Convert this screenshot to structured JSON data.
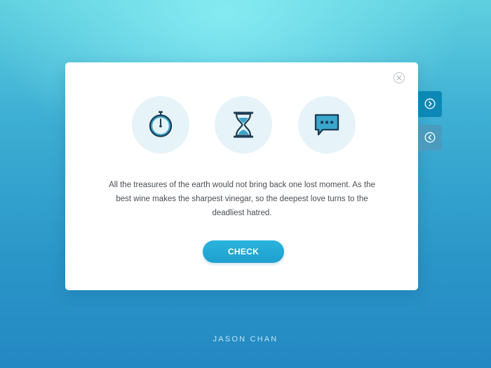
{
  "dialog": {
    "message": "All the treasures of the earth would not bring back one lost moment. As the best wine makes the sharpest vinegar, so the deepest love turns to the deadliest hatred.",
    "check_label": "CHECK",
    "icons": [
      "stopwatch-icon",
      "hourglass-icon",
      "chat-bubble-icon"
    ],
    "close_icon": "close-icon"
  },
  "side_nav": {
    "next_icon": "chevron-right-icon",
    "prev_icon": "chevron-left-icon"
  },
  "footer": {
    "author": "JASON CHAN"
  },
  "colors": {
    "accent": "#1fa8d6",
    "icon_stroke": "#1e3d54",
    "icon_fill": "#3aa6cc",
    "icon_bg": "#e6f3f8",
    "next_tab": "#0d88b6",
    "prev_tab": "#4a9cbf"
  }
}
